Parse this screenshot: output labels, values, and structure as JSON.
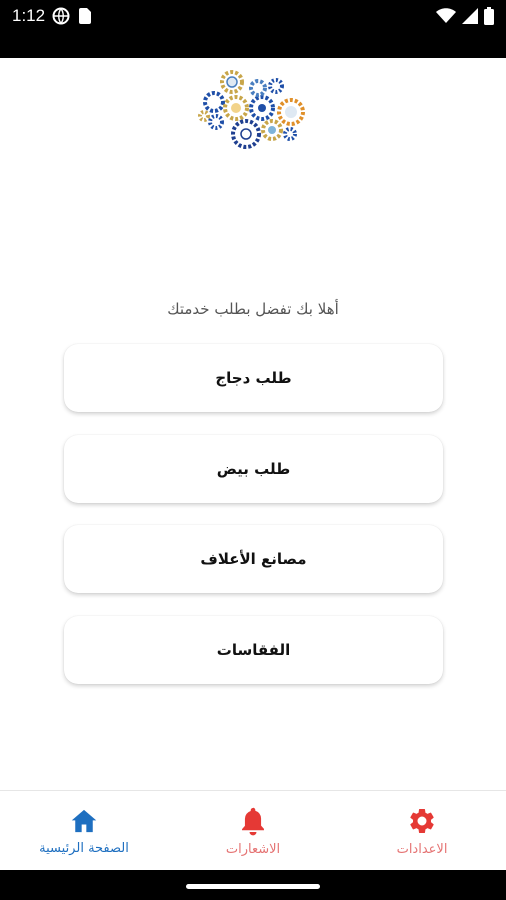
{
  "status_bar": {
    "time": "1:12",
    "icons_left": [
      "vpn-globe-icon",
      "sim-card-icon"
    ],
    "icons_right": [
      "wifi-icon",
      "signal-icon",
      "battery-icon"
    ]
  },
  "greeting": "أهلا بك تفضل بطلب خدمتك",
  "services": [
    {
      "label": "طلب دجاج"
    },
    {
      "label": "طلب بيض"
    },
    {
      "label": "مصانع الأعلاف"
    },
    {
      "label": "الفقاسات"
    }
  ],
  "bottom_nav": {
    "home": {
      "label": "الصفحة الرئيسية",
      "icon": "home-icon",
      "color": "#1e6fc0"
    },
    "notifications": {
      "label": "الاشعارات",
      "icon": "bell-icon",
      "color": "#e53935"
    },
    "settings": {
      "label": "الاعدادات",
      "icon": "gear-icon",
      "color": "#e53935"
    }
  },
  "colors": {
    "accent_blue": "#1e6fc0",
    "accent_red": "#e53935"
  }
}
